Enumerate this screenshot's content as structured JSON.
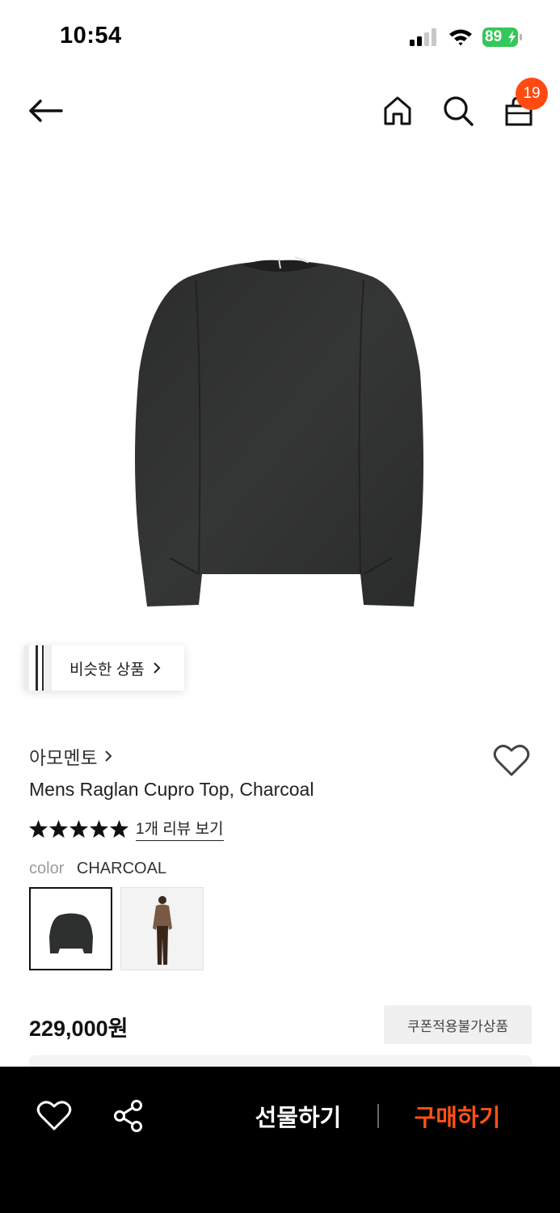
{
  "status_bar": {
    "time": "10:54",
    "battery_percent": "89",
    "signal_icon": "cellular-signal-icon",
    "wifi_icon": "wifi-icon",
    "battery_color": "#34c759"
  },
  "nav": {
    "back_icon": "arrow-left-icon",
    "home_icon": "home-icon",
    "search_icon": "search-icon",
    "cart_icon": "shopping-bag-icon",
    "cart_count": "19",
    "badge_color": "#ff4b12"
  },
  "product": {
    "image_description_icon": "product-photo",
    "similar_label": "비슷한 상품",
    "brand": "아모멘토",
    "title": "Mens Raglan Cupro Top, Charcoal",
    "rating": 5,
    "rating_max": 5,
    "review_link": "1개 리뷰 보기",
    "color_label": "color",
    "color_value": "CHARCOAL",
    "price": "229,000원",
    "coupon_badge": "쿠폰적용불가상품"
  },
  "bottom_bar": {
    "like_icon": "heart-icon",
    "share_icon": "share-icon",
    "gift_label": "선물하기",
    "buy_label": "구매하기",
    "buy_color": "#ff5212"
  }
}
